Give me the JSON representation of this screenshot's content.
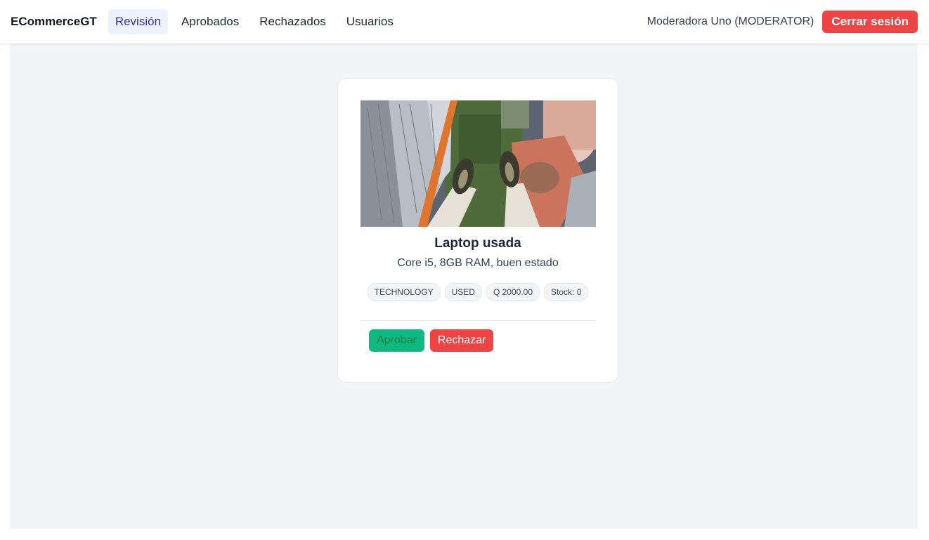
{
  "header": {
    "brand": "ECommerceGT",
    "nav": [
      {
        "label": "Revisión",
        "active": true
      },
      {
        "label": "Aprobados",
        "active": false
      },
      {
        "label": "Rechazados",
        "active": false
      },
      {
        "label": "Usuarios",
        "active": false
      }
    ],
    "user_label": "Moderadora Uno (MODERATOR)",
    "logout_label": "Cerrar sesión"
  },
  "product": {
    "title": "Laptop usada",
    "description": "Core i5, 8GB RAM, buen estado",
    "tags": [
      "TECHNOLOGY",
      "USED",
      "Q 2000.00",
      "Stock: 0"
    ],
    "approve_label": "Aprobar",
    "reject_label": "Rechazar"
  },
  "colors": {
    "accent_active_bg": "#eef2ff",
    "danger": "#ef4444",
    "success": "#10b981"
  }
}
